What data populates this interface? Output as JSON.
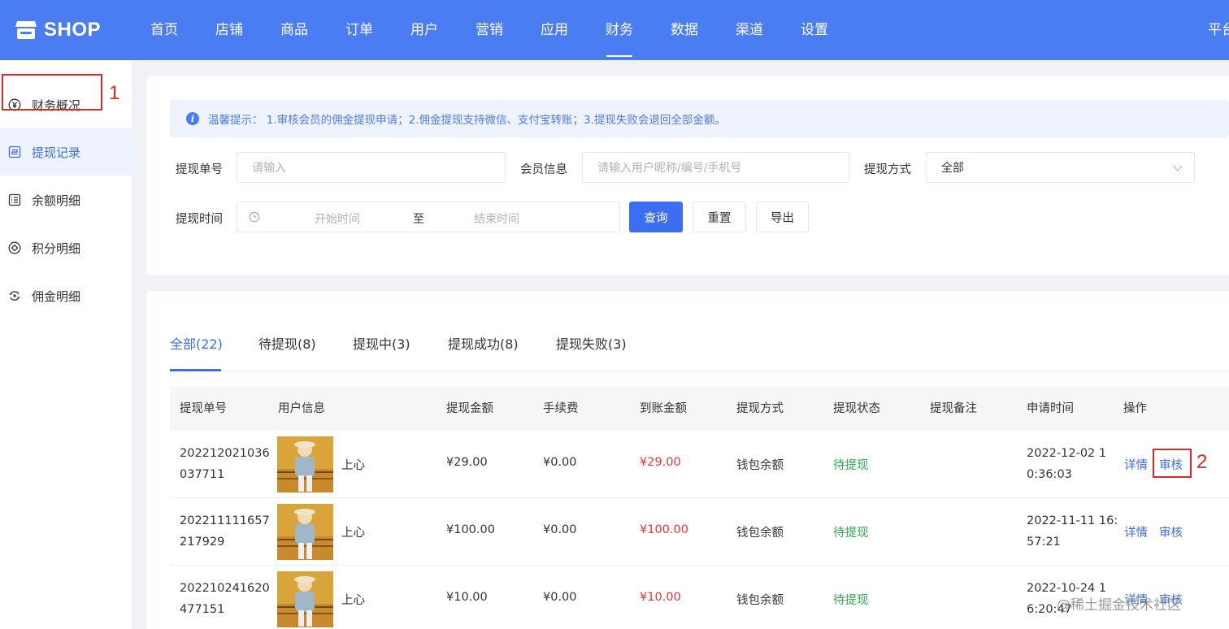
{
  "header": {
    "logo_text": "SHOP",
    "nav": [
      "首页",
      "店铺",
      "商品",
      "订单",
      "用户",
      "营销",
      "应用",
      "财务",
      "数据",
      "渠道",
      "设置"
    ],
    "active_nav": "财务",
    "right_text": "平台"
  },
  "sidebar": {
    "items": [
      {
        "label": "财务概况",
        "icon": "yen-circle-icon"
      },
      {
        "label": "提现记录",
        "icon": "withdraw-record-icon"
      },
      {
        "label": "余额明细",
        "icon": "list-icon"
      },
      {
        "label": "积分明细",
        "icon": "points-diamond-icon"
      },
      {
        "label": "佣金明细",
        "icon": "commission-icon"
      }
    ],
    "active_index": 1
  },
  "annotations": {
    "marker1": "1",
    "marker2": "2"
  },
  "notice": {
    "text": "温馨提示：  1.审核会员的佣金提现申请；2.佣金提现支持微信、支付宝转账；3.提现失败会退回全部金额。"
  },
  "filters": {
    "order_no_label": "提现单号",
    "order_no_placeholder": "请输入",
    "member_label": "会员信息",
    "member_placeholder": "请输入用户昵称/编号/手机号",
    "method_label": "提现方式",
    "method_value": "全部",
    "time_label": "提现时间",
    "start_placeholder": "开始时间",
    "separator": "至",
    "end_placeholder": "结束时间",
    "query_button": "查询",
    "reset_button": "重置",
    "export_button": "导出"
  },
  "tabs": [
    "全部(22)",
    "待提现(8)",
    "提现中(3)",
    "提现成功(8)",
    "提现失败(3)"
  ],
  "table": {
    "headers": [
      "提现单号",
      "用户信息",
      "提现金额",
      "手续费",
      "到账金额",
      "提现方式",
      "提现状态",
      "提现备注",
      "申请时间",
      "操作"
    ],
    "rows": [
      {
        "no_1": "202212021036",
        "no_2": "037711",
        "user": "上心",
        "amount": "¥29.00",
        "fee": "¥0.00",
        "received": "¥29.00",
        "method": "钱包余额",
        "status": "待提现",
        "remark": "",
        "time_1": "2022-12-02 1",
        "time_2": "0:36:03",
        "detail": "详情",
        "audit": "审核"
      },
      {
        "no_1": "202211111657",
        "no_2": "217929",
        "user": "上心",
        "amount": "¥100.00",
        "fee": "¥0.00",
        "received": "¥100.00",
        "method": "钱包余额",
        "status": "待提现",
        "remark": "",
        "time_1": "2022-11-11 16:",
        "time_2": "57:21",
        "detail": "详情",
        "audit": "审核"
      },
      {
        "no_1": "202210241620",
        "no_2": "477151",
        "user": "上心",
        "amount": "¥10.00",
        "fee": "¥0.00",
        "received": "¥10.00",
        "method": "钱包余额",
        "status": "待提现",
        "remark": "",
        "time_1": "2022-10-24 1",
        "time_2": "6:20:47",
        "detail": "详情",
        "audit": "审核"
      }
    ]
  },
  "watermark": "@稀土掘金技术社区",
  "colors": {
    "primary": "#3b6ef0",
    "header_bg": "#4a7cf2",
    "amount_red": "#e8343a",
    "status_green": "#34a853",
    "annotation_red": "#e02828"
  }
}
